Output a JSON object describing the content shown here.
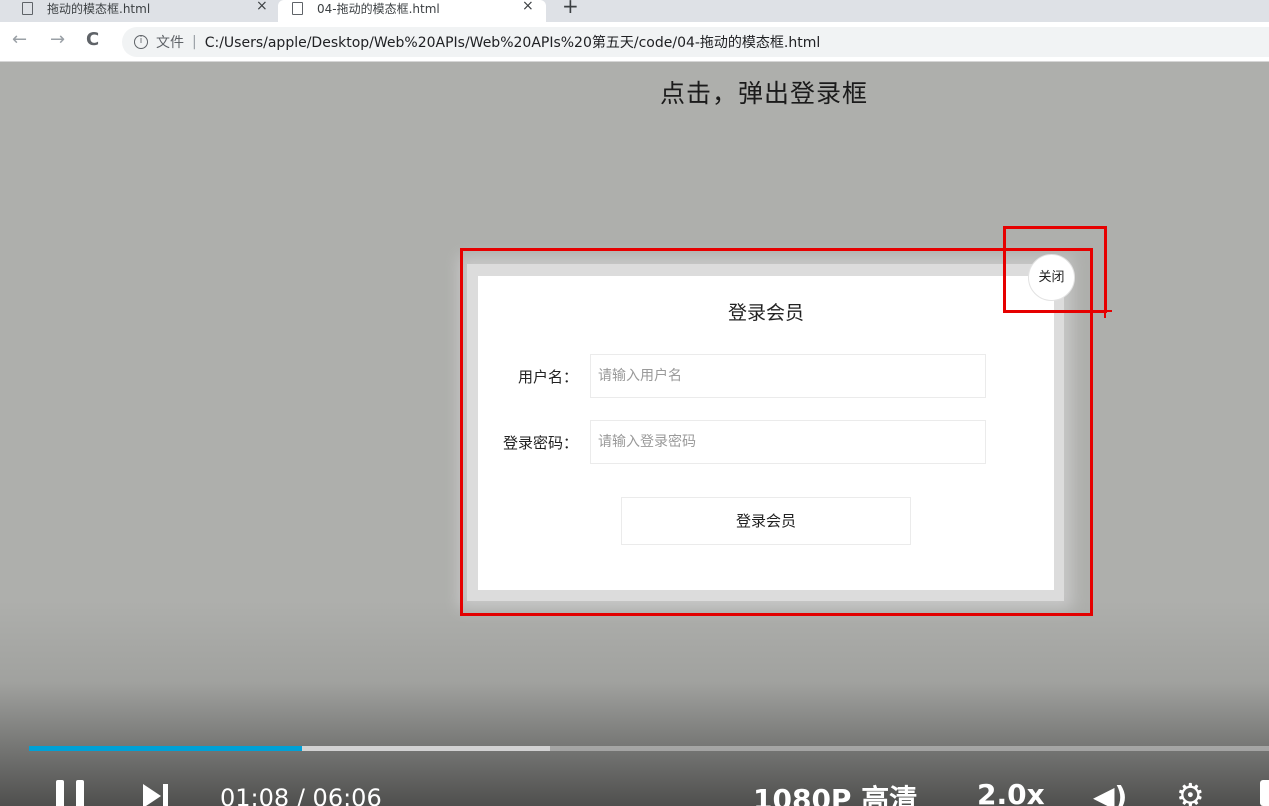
{
  "browser": {
    "tabs": [
      {
        "title": "拖动的模态框.html",
        "close": "×"
      },
      {
        "title": "04-拖动的模态框.html",
        "close": "×"
      }
    ],
    "new_tab": "+",
    "nav": {
      "back": "←",
      "forward": "→",
      "reload": "C"
    },
    "address": {
      "info": "i",
      "scheme_label": "文件",
      "separator": "|",
      "url": "C:/Users/apple/Desktop/Web%20APIs/Web%20APIs%20第五天/code/04-拖动的模态框.html"
    }
  },
  "page": {
    "heading": "点击，弹出登录框"
  },
  "modal": {
    "title": "登录会员",
    "close_label": "关闭",
    "username_label": "用户名：",
    "username_placeholder": "请输入用户名",
    "password_label": "登录密码：",
    "password_placeholder": "请输入登录密码",
    "submit_label": "登录会员"
  },
  "player": {
    "played_fraction": 0.22,
    "buffered_fraction": 0.42,
    "current_time": "01:08",
    "time_separator": "/",
    "duration": "06:06",
    "quality": "1080P 高清",
    "speed": "2.0x",
    "volume_icon": "◀)",
    "settings_icon": "⚙",
    "accent": "#00a1d6"
  },
  "annotation": {
    "color": "#e60000"
  }
}
